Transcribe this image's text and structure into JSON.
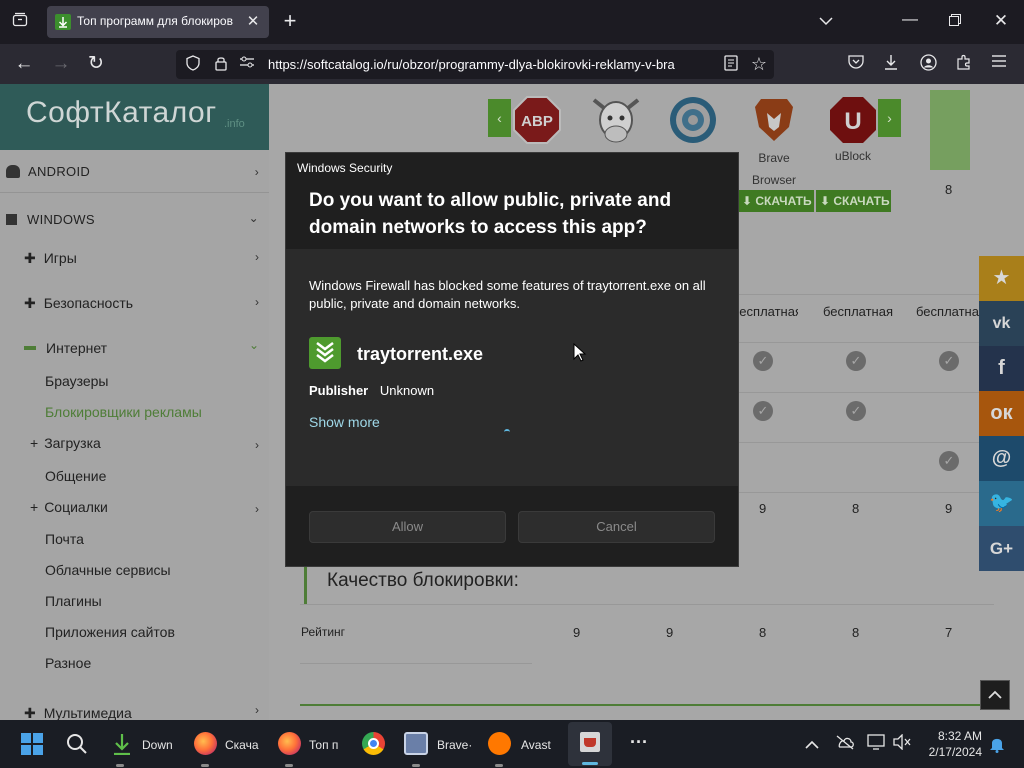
{
  "browser": {
    "tab_title": "Топ программ для блокиров",
    "url": "https://softcatalog.io/ru/obzor/programmy-dlya-blokirovki-reklamy-v-bra"
  },
  "site": {
    "logo": "СофтКаталог",
    "logo_suffix": ".info",
    "sidebar": {
      "android": "ANDROID",
      "windows": "WINDOWS",
      "games": "Игры",
      "security": "Безопасность",
      "internet": "Интернет",
      "browsers": "Браузеры",
      "adblockers": "Блокировщики рекламы",
      "download": "Загрузка",
      "communication": "Общение",
      "social": "Социалки",
      "mail": "Почта",
      "cloud": "Облачные сервисы",
      "plugins": "Плагины",
      "site_apps": "Приложения сайтов",
      "misc": "Разное",
      "multimedia": "Мультимедиа"
    },
    "products": {
      "brave_line1": "Brave",
      "brave_line2": "Browser",
      "ublock": "uBlock",
      "top_score": "8"
    },
    "download_label": "СКАЧАТЬ",
    "license": "бесплатная",
    "scores_row": [
      "9",
      "8",
      "9"
    ],
    "section_title": "Качество блокировки:",
    "rating_label": "Рейтинг",
    "rating_values": [
      "9",
      "9",
      "8",
      "8",
      "7"
    ]
  },
  "dialog": {
    "window_title": "Windows Security",
    "question": "Do you want to allow public, private and domain networks to access this app?",
    "body": "Windows Firewall has blocked some features of traytorrent.exe on all public, private and domain networks.",
    "app_name": "traytorrent.exe",
    "publisher_label": "Publisher",
    "publisher_value": "Unknown",
    "show_more": "Show more",
    "allow": "Allow",
    "cancel": "Cancel"
  },
  "taskbar": {
    "apps": [
      "Down",
      "Скача",
      "Топ п",
      "Brave·",
      "Avast"
    ],
    "more": "···",
    "time": "8:32 AM",
    "date": "2/17/2024"
  }
}
